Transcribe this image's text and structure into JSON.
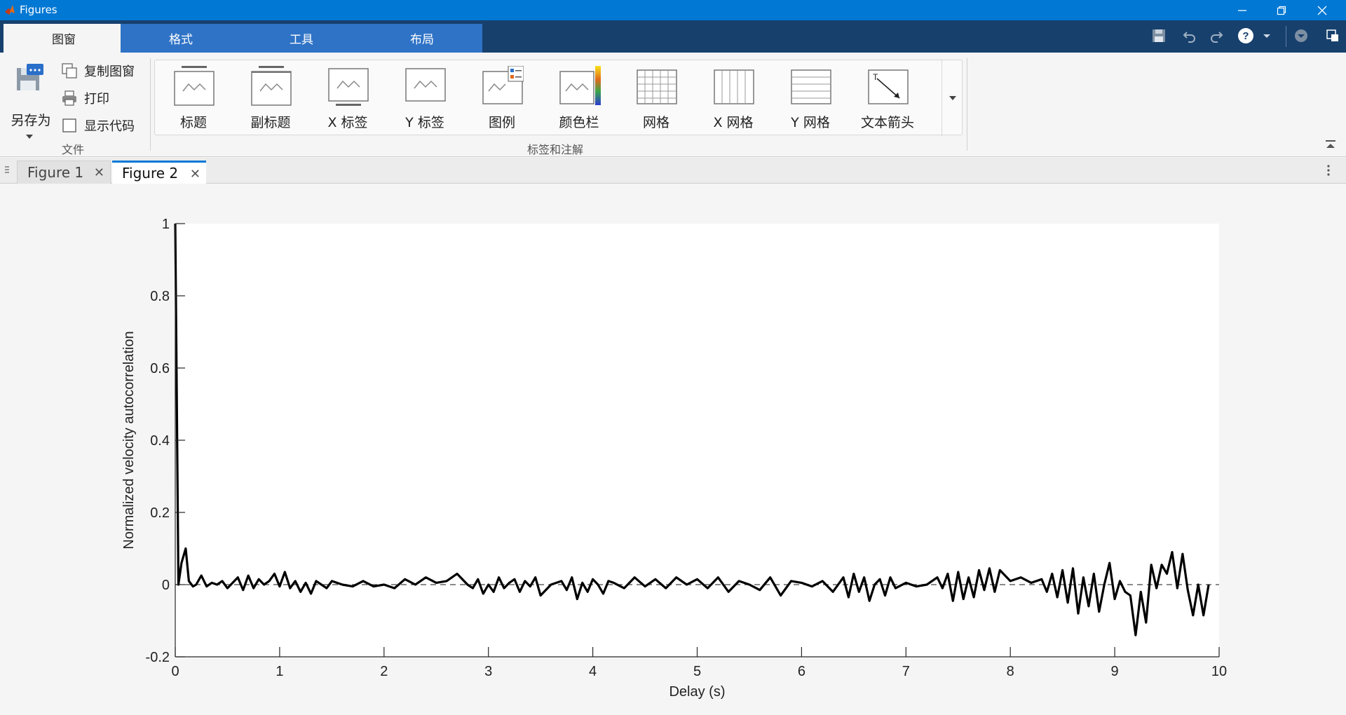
{
  "window": {
    "title": "Figures",
    "icon": "matlab-logo-icon"
  },
  "tabs": [
    {
      "label": "图窗",
      "active": true
    },
    {
      "label": "格式",
      "active": false
    },
    {
      "label": "工具",
      "active": false
    },
    {
      "label": "布局",
      "active": false
    }
  ],
  "file_section": {
    "save_as_label": "另存为",
    "copy_figure_label": "复制图窗",
    "print_label": "打印",
    "show_code_label": "显示代码",
    "show_code_checked": false,
    "section_label": "文件"
  },
  "annotations": {
    "section_label": "标签和注解",
    "buttons": [
      {
        "label": "标题",
        "icon": "title-icon"
      },
      {
        "label": "副标题",
        "icon": "subtitle-icon"
      },
      {
        "label": "X 标签",
        "icon": "xlabel-icon"
      },
      {
        "label": "Y 标签",
        "icon": "ylabel-icon"
      },
      {
        "label": "图例",
        "icon": "legend-icon"
      },
      {
        "label": "颜色栏",
        "icon": "colorbar-icon"
      },
      {
        "label": "网格",
        "icon": "grid-icon"
      },
      {
        "label": "X 网格",
        "icon": "xgrid-icon"
      },
      {
        "label": "Y 网格",
        "icon": "ygrid-icon"
      },
      {
        "label": "文本箭头",
        "icon": "text-arrow-icon"
      }
    ]
  },
  "figure_tabs": [
    {
      "label": "Figure 1",
      "active": false
    },
    {
      "label": "Figure 2",
      "active": true
    }
  ],
  "colors": {
    "titlebar": "#0078d4",
    "tabstrip": "#17406d",
    "tab_inactive": "#2f73c6",
    "plot_line": "#000000"
  },
  "chart_data": {
    "type": "line",
    "title": "",
    "xlabel": "Delay (s)",
    "ylabel": "Normalized velocity autocorrelation",
    "xlim": [
      0,
      10
    ],
    "ylim": [
      -0.2,
      1
    ],
    "xticks": [
      "0",
      "1",
      "2",
      "3",
      "4",
      "5",
      "6",
      "7",
      "8",
      "9",
      "10"
    ],
    "yticks": [
      "-0.2",
      "0",
      "0.2",
      "0.4",
      "0.6",
      "0.8",
      "1"
    ],
    "reference_line": {
      "y": 0,
      "style": "dashed"
    },
    "grid": false,
    "series": [
      {
        "x": [
          0,
          0.03,
          0.06,
          0.1,
          0.13,
          0.17,
          0.2,
          0.25,
          0.3,
          0.35,
          0.4,
          0.45,
          0.5,
          0.55,
          0.6,
          0.65,
          0.7,
          0.75,
          0.8,
          0.85,
          0.9,
          0.95,
          1.0,
          1.05,
          1.1,
          1.15,
          1.2,
          1.25,
          1.3,
          1.35,
          1.4,
          1.45,
          1.5,
          1.6,
          1.7,
          1.8,
          1.9,
          2.0,
          2.1,
          2.2,
          2.3,
          2.4,
          2.5,
          2.6,
          2.7,
          2.8,
          2.85,
          2.9,
          2.95,
          3.0,
          3.05,
          3.1,
          3.15,
          3.2,
          3.25,
          3.3,
          3.35,
          3.4,
          3.45,
          3.5,
          3.6,
          3.7,
          3.75,
          3.8,
          3.85,
          3.9,
          3.95,
          4.0,
          4.05,
          4.1,
          4.15,
          4.2,
          4.3,
          4.4,
          4.5,
          4.6,
          4.7,
          4.8,
          4.9,
          5.0,
          5.1,
          5.2,
          5.3,
          5.4,
          5.5,
          5.6,
          5.7,
          5.8,
          5.9,
          6.0,
          6.1,
          6.2,
          6.3,
          6.4,
          6.45,
          6.5,
          6.55,
          6.6,
          6.65,
          6.7,
          6.75,
          6.8,
          6.85,
          6.9,
          7.0,
          7.1,
          7.2,
          7.3,
          7.35,
          7.4,
          7.45,
          7.5,
          7.55,
          7.6,
          7.65,
          7.7,
          7.75,
          7.8,
          7.85,
          7.9,
          8.0,
          8.1,
          8.2,
          8.3,
          8.35,
          8.4,
          8.45,
          8.5,
          8.55,
          8.6,
          8.65,
          8.7,
          8.75,
          8.8,
          8.85,
          8.9,
          8.95,
          9.0,
          9.05,
          9.1,
          9.15,
          9.2,
          9.25,
          9.3,
          9.35,
          9.4,
          9.45,
          9.5,
          9.55,
          9.6,
          9.65,
          9.7,
          9.75,
          9.8,
          9.85,
          9.9
        ],
        "y": [
          1.0,
          0.0,
          0.06,
          0.1,
          0.01,
          -0.005,
          0.0,
          0.025,
          -0.005,
          0.005,
          0.0,
          0.01,
          -0.01,
          0.005,
          0.02,
          -0.015,
          0.025,
          -0.01,
          0.015,
          0.0,
          0.01,
          0.03,
          -0.005,
          0.035,
          -0.01,
          0.01,
          -0.02,
          0.005,
          -0.025,
          0.01,
          0.0,
          -0.01,
          0.01,
          0.0,
          -0.005,
          0.01,
          -0.005,
          0.0,
          -0.01,
          0.015,
          0.0,
          0.02,
          0.005,
          0.01,
          0.03,
          0.0,
          -0.01,
          0.015,
          -0.025,
          0.0,
          -0.02,
          0.02,
          -0.01,
          0.005,
          0.015,
          -0.02,
          0.01,
          -0.005,
          0.02,
          -0.03,
          0.0,
          0.01,
          -0.015,
          0.02,
          -0.04,
          0.005,
          -0.02,
          0.015,
          0.0,
          -0.025,
          0.01,
          0.005,
          -0.01,
          0.02,
          -0.005,
          0.015,
          -0.01,
          0.02,
          0.0,
          0.015,
          -0.01,
          0.02,
          -0.02,
          0.01,
          0.0,
          -0.015,
          0.02,
          -0.03,
          0.01,
          0.005,
          -0.005,
          0.01,
          -0.02,
          0.02,
          -0.035,
          0.03,
          -0.02,
          0.02,
          -0.045,
          0.0,
          0.015,
          -0.03,
          0.02,
          -0.01,
          0.005,
          -0.005,
          0.0,
          0.02,
          -0.01,
          0.03,
          -0.045,
          0.035,
          -0.04,
          0.02,
          -0.035,
          0.04,
          -0.015,
          0.045,
          -0.02,
          0.04,
          0.01,
          0.02,
          0.005,
          0.015,
          -0.02,
          0.03,
          -0.035,
          0.04,
          -0.05,
          0.045,
          -0.08,
          0.02,
          -0.06,
          0.03,
          -0.075,
          0.0,
          0.06,
          -0.04,
          0.01,
          -0.02,
          -0.03,
          -0.14,
          -0.02,
          -0.105,
          0.055,
          -0.01,
          0.055,
          0.03,
          0.09,
          -0.01,
          0.085,
          -0.015,
          -0.085,
          0.0,
          -0.085,
          0.0
        ]
      }
    ]
  }
}
